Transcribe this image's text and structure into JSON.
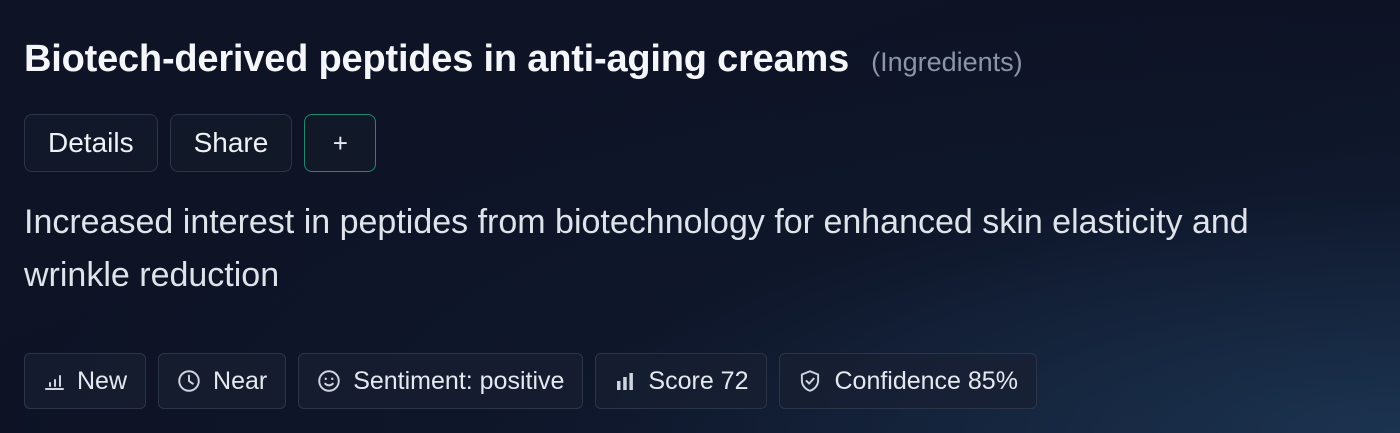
{
  "card": {
    "title": "Biotech-derived peptides in anti-aging creams",
    "category": "(Ingredients)",
    "actions": {
      "details_label": "Details",
      "share_label": "Share",
      "add_label": "+"
    },
    "description": "Increased interest in peptides from biotechnology for enhanced skin elasticity and wrinkle reduction",
    "chips": [
      {
        "icon": "bar-chart-small-icon",
        "label": "New"
      },
      {
        "icon": "clock-icon",
        "label": "Near"
      },
      {
        "icon": "smiley-icon",
        "label": "Sentiment: positive"
      },
      {
        "icon": "bar-chart-icon",
        "label": "Score 72"
      },
      {
        "icon": "shield-check-icon",
        "label": "Confidence 85%"
      }
    ]
  },
  "colors": {
    "background": "#0d1324",
    "border": "#2c3547",
    "accent_border": "#1f8a70",
    "muted_text": "#8a95a8"
  }
}
